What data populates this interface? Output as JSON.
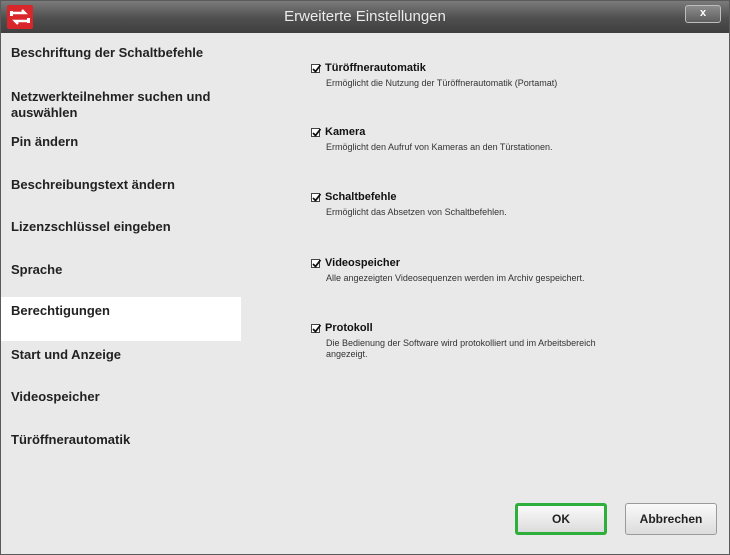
{
  "window": {
    "title": "Erweiterte Einstellungen",
    "close_label": "x"
  },
  "sidebar": {
    "items": [
      {
        "label": "Beschriftung der Schaltbefehle"
      },
      {
        "label": "Netzwerkteilnehmer suchen und auswählen"
      },
      {
        "label": "Pin ändern"
      },
      {
        "label": "Beschreibungstext ändern"
      },
      {
        "label": "Lizenzschlüssel eingeben"
      },
      {
        "label": "Sprache"
      },
      {
        "label": "Berechtigungen",
        "selected": true
      },
      {
        "label": "Start und Anzeige"
      },
      {
        "label": "Videospeicher"
      },
      {
        "label": "Türöffnerautomatik"
      }
    ]
  },
  "permissions": [
    {
      "title": "Türöffnerautomatik",
      "checked": true,
      "description": "Ermöglicht die Nutzung der Türöffnerautomatik (Portamat)"
    },
    {
      "title": "Kamera",
      "checked": true,
      "description": "Ermöglicht den Aufruf von Kameras an den Türstationen."
    },
    {
      "title": "Schaltbefehle",
      "checked": true,
      "description": "Ermöglicht das Absetzen von Schaltbefehlen."
    },
    {
      "title": "Videospeicher",
      "checked": true,
      "description": "Alle angezeigten Videosequenzen werden im Archiv gespeichert."
    },
    {
      "title": "Protokoll",
      "checked": true,
      "description": "Die Bedienung der Software wird protokolliert und im Arbeitsbereich angezeigt."
    }
  ],
  "buttons": {
    "ok": "OK",
    "cancel": "Abbrechen"
  },
  "colors": {
    "titlebar": "#4e4e4e",
    "brand": "#d8262a",
    "ok_focus": "#2eae3a",
    "selected_item": "#ffffff"
  }
}
